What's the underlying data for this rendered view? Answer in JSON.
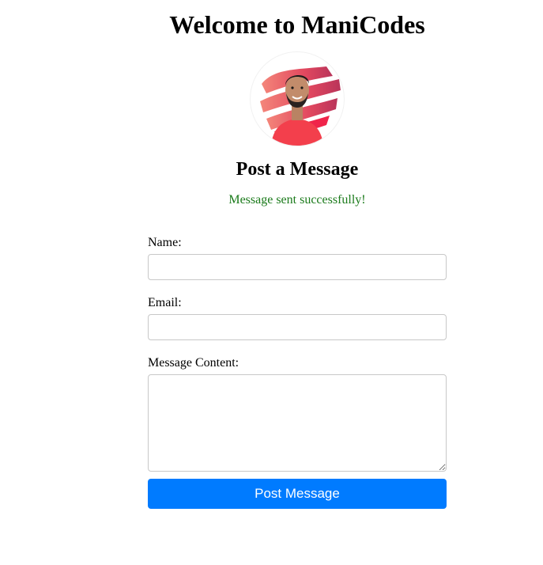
{
  "header": {
    "title": "Welcome to ManiCodes"
  },
  "profile": {
    "avatar_icon": "profile-photo"
  },
  "form_section": {
    "title": "Post a Message",
    "status_message": "Message sent successfully!",
    "status_color": "#1a7a1a",
    "fields": {
      "name": {
        "label": "Name:",
        "value": "",
        "placeholder": ""
      },
      "email": {
        "label": "Email:",
        "value": "",
        "placeholder": ""
      },
      "message": {
        "label": "Message Content:",
        "value": "",
        "placeholder": ""
      }
    },
    "submit_label": "Post Message",
    "accent_color": "#007bff"
  }
}
